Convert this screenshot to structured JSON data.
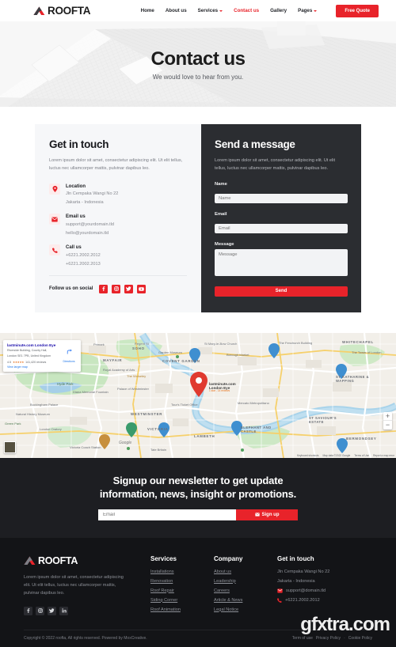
{
  "brand": {
    "name": "ROOFTA",
    "logo_icon": "roof-logo-icon"
  },
  "header": {
    "nav": [
      {
        "label": "Home",
        "active": false,
        "caret": false
      },
      {
        "label": "About us",
        "active": false,
        "caret": false
      },
      {
        "label": "Services",
        "active": false,
        "caret": true
      },
      {
        "label": "Contact us",
        "active": true,
        "caret": false
      },
      {
        "label": "Gallery",
        "active": false,
        "caret": false
      },
      {
        "label": "Pages",
        "active": false,
        "caret": true
      }
    ],
    "cta_label": "Free Quote"
  },
  "hero": {
    "title": "Contact us",
    "subtitle": "We would love to hear from you."
  },
  "get_in_touch": {
    "title": "Get in touch",
    "description": "Lorem ipsum dolor sit amet, consectetur adipiscing elit. Ut elit tellus, luctus nec ullamcorper mattis, pulvinar dapibus leo.",
    "items": [
      {
        "icon": "location-pin-icon",
        "label": "Location",
        "lines": [
          "Jln Cempaka Wangi No 22",
          "Jakarta - Indonesia"
        ]
      },
      {
        "icon": "envelope-icon",
        "label": "Email us",
        "lines": [
          "support@yourdomain.tld",
          "hello@yourdomain.tld"
        ]
      },
      {
        "icon": "phone-icon",
        "label": "Call us",
        "lines": [
          "+6221.2002.2012",
          "+6221.2002.2013"
        ]
      }
    ],
    "social_label": "Follow us on social",
    "socials": [
      "facebook-icon",
      "instagram-icon",
      "twitter-icon",
      "youtube-icon"
    ]
  },
  "send_message": {
    "title": "Send a message",
    "description": "Lorem ipsum dolor sit amet, consectetur adipiscing elit. Ut elit tellus, luctus nec ullamcorper mattis, pulvinar dapibus leo.",
    "fields": [
      {
        "label": "Name",
        "placeholder": "Name",
        "value": ""
      },
      {
        "label": "Email",
        "placeholder": "Email",
        "value": ""
      },
      {
        "label": "Message",
        "placeholder": "Message",
        "value": ""
      }
    ],
    "submit_label": "Send"
  },
  "map": {
    "card": {
      "title": "lastminute.com London Eye",
      "address_line1": "Riverside Building, County Hall,",
      "address_line2": "London SE1 7PB, United Kingdom",
      "rating": "4.5",
      "stars": "★★★★★",
      "reviews": "141,420 reviews",
      "view_link": "View larger map",
      "directions_label": "Directions",
      "directions_icon": "directions-icon"
    },
    "pin_label_line1": "lastminute.com",
    "pin_label_line2": "London Eye",
    "pin_label_line3": "1 star - 14 reviews",
    "zoom_in": "+",
    "zoom_out": "−",
    "logo_text": "Google",
    "attribution": [
      "Keyboard shortcuts",
      "Map data ©2022 Google",
      "Terms of Use",
      "Report a map error"
    ],
    "labels": [
      "MAYFAIR",
      "SOHO",
      "COVENT GARDEN",
      "WHITECHAPEL",
      "ST KATHARINE & WAPPING",
      "VICTORIA",
      "LAMBETH",
      "ELEPHANT AND CASTLE",
      "BERMONDSEY",
      "WESTMINSTER",
      "ST SAVIOUR'S ESTATE",
      "Hyde Park",
      "The Wolseley",
      "Primark",
      "Regent St",
      "Royal Academy of Arts",
      "Buckingham Palace",
      "Tate Britain",
      "Victoria Coach Station",
      "Borough Market",
      "Natural History Museum",
      "London Oratory",
      "Green Park",
      "The Fenchurch Building",
      "The Tower of London",
      "Mercato Metropolitano",
      "Garden Museum",
      "Palace of Westminster",
      "Tour's Ticket Office",
      "Diana Memorial Fountain",
      "St Mary-le-Bow Church"
    ]
  },
  "newsletter": {
    "title_line1": "Signup our newsletter to get update",
    "title_line2": "information, news, insight or promotions.",
    "placeholder": "Email",
    "value": "",
    "button_label": "Sign up",
    "button_icon": "envelope-icon"
  },
  "footer": {
    "description": "Lorem ipsum dolor sit amet, consectetur adipiscing elit. Ut elit tellus, luctus nec ullamcorper mattis, pulvinar dapibus leo.",
    "socials": [
      "facebook-icon",
      "instagram-icon",
      "twitter-icon",
      "linkedin-icon"
    ],
    "columns": [
      {
        "title": "Services",
        "links": [
          "Installations",
          "Renovation",
          "Roof Repair",
          "Siding Corner",
          "Roof Animation"
        ]
      },
      {
        "title": "Company",
        "links": [
          "About us",
          "Leadership",
          "Careers",
          "Article & News",
          "Legal Notice"
        ]
      }
    ],
    "contact": {
      "title": "Get in touch",
      "address_line1": "Jln Cempaka Wangi No 22",
      "address_line2": "Jakarta - Indonesia",
      "email": "support@domain.tld",
      "email_icon": "envelope-icon",
      "phone": "+6221.2002.2012",
      "phone_icon": "phone-icon"
    },
    "copyright": "Copyright © 2022 roofta, All rights reserved. Powered by MoxCreative.",
    "legal": [
      "Term of use",
      "Privacy Policy",
      "Cookie Policy"
    ],
    "separator": "-"
  },
  "watermark": "gfxtra.com",
  "colors": {
    "accent": "#e8232a",
    "dark_panel": "#2b2d31",
    "footer": "#131417",
    "newsletter": "#1d1e22"
  }
}
